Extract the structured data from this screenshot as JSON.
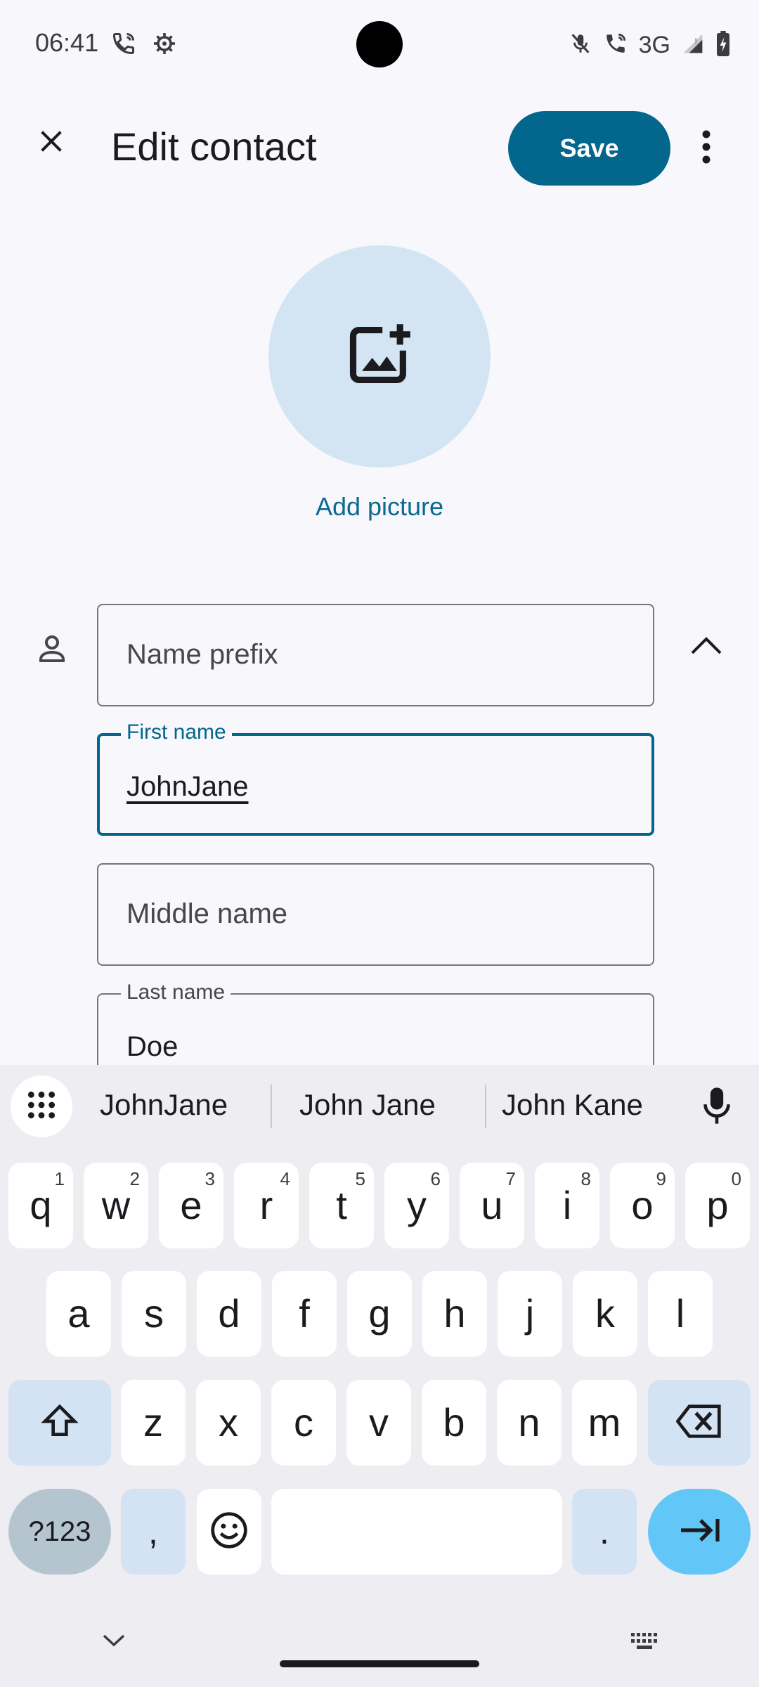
{
  "status_bar": {
    "time": "06:41",
    "network": "3G"
  },
  "app_bar": {
    "title": "Edit contact",
    "save_label": "Save"
  },
  "avatar": {
    "add_picture_label": "Add picture"
  },
  "form": {
    "name_prefix": {
      "placeholder": "Name prefix",
      "value": ""
    },
    "first_name": {
      "label": "First name",
      "value": "JohnJane",
      "focused": true
    },
    "middle_name": {
      "placeholder": "Middle name",
      "value": ""
    },
    "last_name": {
      "label": "Last name",
      "value": "Doe"
    }
  },
  "keyboard": {
    "suggestions": [
      "JohnJane",
      "John Jane",
      "John Kane"
    ],
    "row1": [
      {
        "ch": "q",
        "sup": "1"
      },
      {
        "ch": "w",
        "sup": "2"
      },
      {
        "ch": "e",
        "sup": "3"
      },
      {
        "ch": "r",
        "sup": "4"
      },
      {
        "ch": "t",
        "sup": "5"
      },
      {
        "ch": "y",
        "sup": "6"
      },
      {
        "ch": "u",
        "sup": "7"
      },
      {
        "ch": "i",
        "sup": "8"
      },
      {
        "ch": "o",
        "sup": "9"
      },
      {
        "ch": "p",
        "sup": "0"
      }
    ],
    "row2": [
      "a",
      "s",
      "d",
      "f",
      "g",
      "h",
      "j",
      "k",
      "l"
    ],
    "row3": [
      "z",
      "x",
      "c",
      "v",
      "b",
      "n",
      "m"
    ],
    "symbols_label": "?123",
    "comma": ",",
    "period": "."
  },
  "colors": {
    "accent": "#03668d",
    "background": "#f8f7fc",
    "avatar_bg": "#d3e5f3",
    "keyboard_bg": "#eeedf2",
    "enter_key": "#62c6f7"
  }
}
